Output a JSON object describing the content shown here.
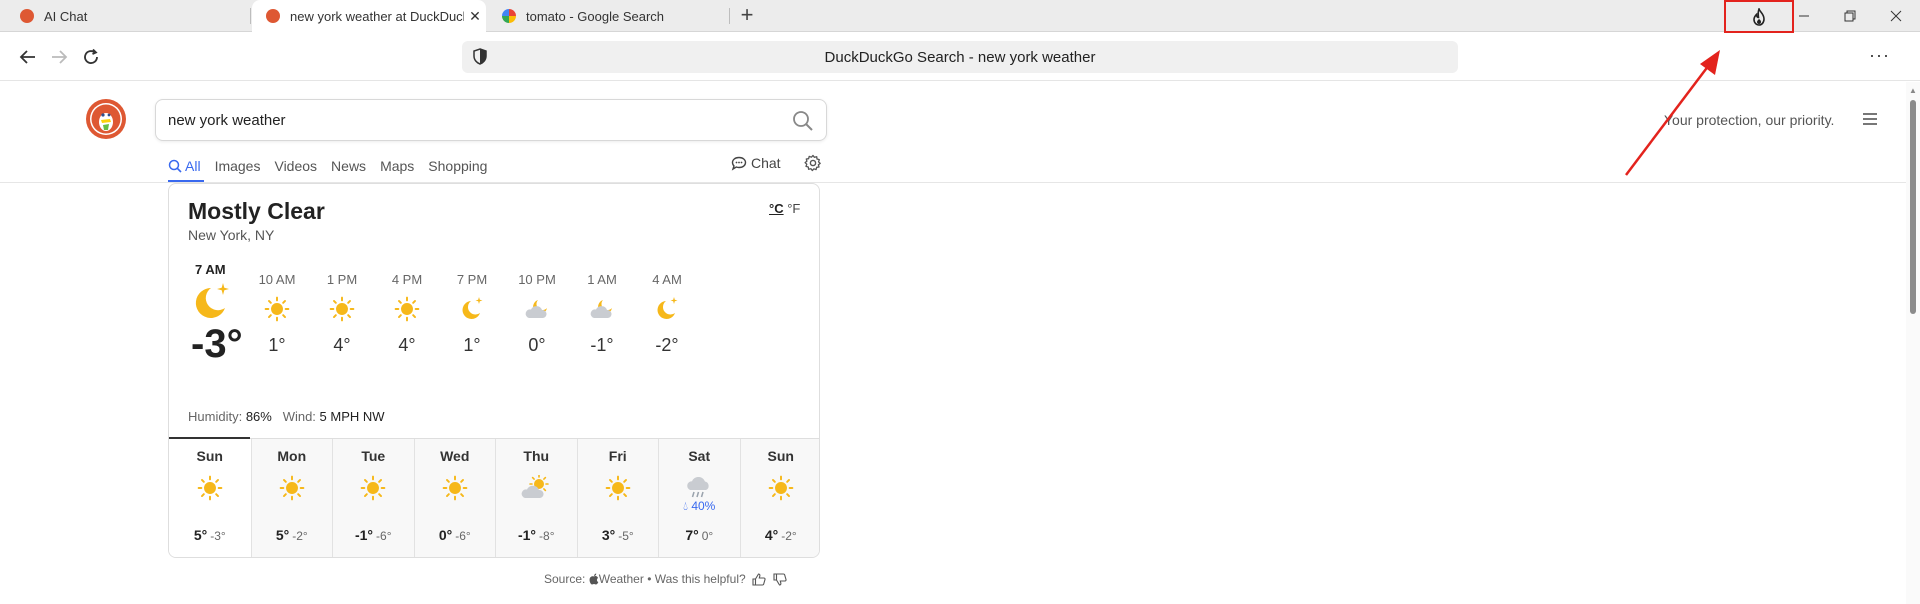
{
  "browser": {
    "tabs": [
      {
        "title": "AI Chat",
        "active": false,
        "favicon": "duckduckgo-icon"
      },
      {
        "title": "new york weather at DuckDuckGo",
        "active": true,
        "favicon": "duckduckgo-icon"
      },
      {
        "title": "tomato - Google Search",
        "active": false,
        "favicon": "google-icon"
      }
    ],
    "new_tab": "+",
    "address": "DuckDuckGo Search - new york weather",
    "more": "···",
    "fire_button": "fire-icon"
  },
  "page": {
    "search_value": "new york weather",
    "tagline": "Your protection, our priority.",
    "verticals": [
      "All",
      "Images",
      "Videos",
      "News",
      "Maps",
      "Shopping"
    ],
    "chat": "Chat"
  },
  "weather": {
    "condition": "Mostly Clear",
    "location": "New York, NY",
    "unit_c": "°C",
    "unit_f": "°F",
    "now": {
      "time": "7 AM",
      "temp": "-3°",
      "icon": "moon-star-icon"
    },
    "hourly": [
      {
        "time": "10 AM",
        "temp": "1°",
        "icon": "sun"
      },
      {
        "time": "1 PM",
        "temp": "4°",
        "icon": "sun"
      },
      {
        "time": "4 PM",
        "temp": "4°",
        "icon": "sun"
      },
      {
        "time": "7 PM",
        "temp": "1°",
        "icon": "moon"
      },
      {
        "time": "10 PM",
        "temp": "0°",
        "icon": "cloud-moon"
      },
      {
        "time": "1 AM",
        "temp": "-1°",
        "icon": "cloud-moon"
      },
      {
        "time": "4 AM",
        "temp": "-2°",
        "icon": "moon"
      }
    ],
    "humidity_label": "Humidity:",
    "humidity": "86%",
    "wind_label": "Wind:",
    "wind": "5 MPH NW",
    "daily": [
      {
        "day": "Sun",
        "hi": "5°",
        "lo": "-3°",
        "icon": "sun",
        "precip": ""
      },
      {
        "day": "Mon",
        "hi": "5°",
        "lo": "-2°",
        "icon": "sun",
        "precip": ""
      },
      {
        "day": "Tue",
        "hi": "-1°",
        "lo": "-6°",
        "icon": "sun",
        "precip": ""
      },
      {
        "day": "Wed",
        "hi": "0°",
        "lo": "-6°",
        "icon": "sun",
        "precip": ""
      },
      {
        "day": "Thu",
        "hi": "-1°",
        "lo": "-8°",
        "icon": "cloud-sun",
        "precip": ""
      },
      {
        "day": "Fri",
        "hi": "3°",
        "lo": "-5°",
        "icon": "sun",
        "precip": ""
      },
      {
        "day": "Sat",
        "hi": "7°",
        "lo": "0°",
        "icon": "rain",
        "precip": "40%"
      },
      {
        "day": "Sun",
        "hi": "4°",
        "lo": "-2°",
        "icon": "sun",
        "precip": ""
      }
    ],
    "source_label": "Source:",
    "source_name": "Weather",
    "helpful": "• Was this helpful?"
  },
  "colors": {
    "accent": "#3969ef",
    "sun": "#f6b81a",
    "highlight_red": "#e3231d"
  }
}
